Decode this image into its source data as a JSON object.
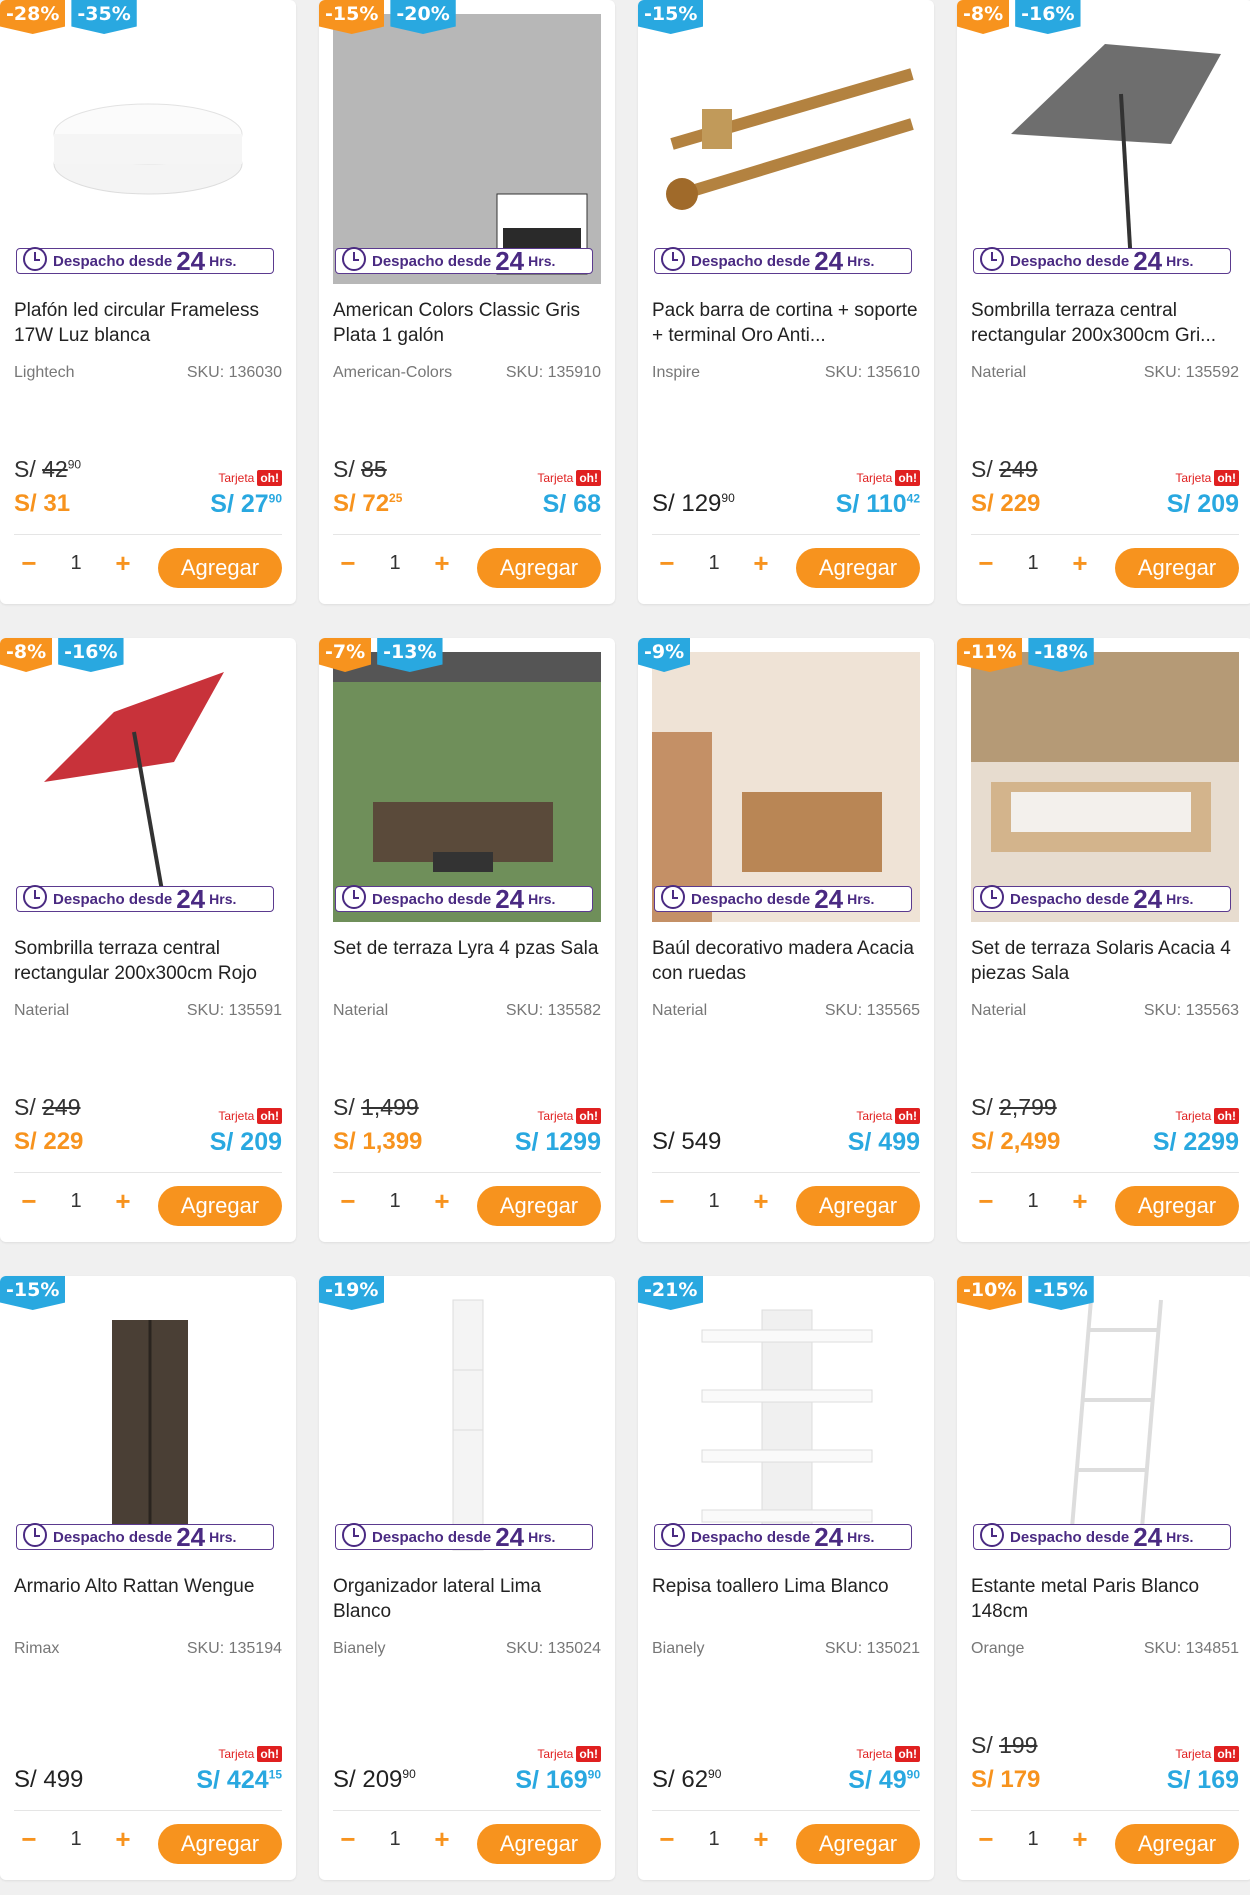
{
  "shipping": {
    "prefix": "Despacho desde",
    "num": "24",
    "unit": "Hrs."
  },
  "tarjeta_label": "Tarjeta",
  "tarjeta_oh": "oh!",
  "qty_minus": "−",
  "qty_plus": "+",
  "add_label": "Agregar",
  "currency": "S/",
  "accent_orange": "#f7931e",
  "accent_blue": "#29a8e0",
  "products": [
    {
      "badges": [
        "-28%",
        "-35%"
      ],
      "title": "Plafón led circular Frameless 17W Luz blanca",
      "brand": "Lightech",
      "sku": "SKU: 136030",
      "old": "42",
      "old_cents": "90",
      "price": "S/ 31",
      "price_cents": "",
      "tarjeta_price": "S/ 27",
      "tarjeta_cents": "90",
      "qty": "1",
      "icon": "ceiling-lamp"
    },
    {
      "badges": [
        "-15%",
        "-20%"
      ],
      "title": "American Colors Classic Gris Plata 1 galón",
      "brand": "American-Colors",
      "sku": "SKU: 135910",
      "old": "85",
      "old_cents": "",
      "price": "S/ 72",
      "price_cents": "25",
      "tarjeta_price": "S/ 68",
      "tarjeta_cents": "",
      "qty": "1",
      "icon": "paint-bucket"
    },
    {
      "badges": [
        "-15%"
      ],
      "title": "Pack barra de cortina + soporte + terminal Oro Anti...",
      "brand": "Inspire",
      "sku": "SKU: 135610",
      "old": "",
      "old_cents": "",
      "price": "S/ 129",
      "price_cents": "90",
      "tarjeta_price": "S/ 110",
      "tarjeta_cents": "42",
      "qty": "1",
      "icon": "curtain-rod"
    },
    {
      "badges": [
        "-8%",
        "-16%"
      ],
      "title": "Sombrilla terraza central rectangular 200x300cm Gri...",
      "brand": "Naterial",
      "sku": "SKU: 135592",
      "old": "249",
      "old_cents": "",
      "price": "S/ 229",
      "price_cents": "",
      "tarjeta_price": "S/ 209",
      "tarjeta_cents": "",
      "qty": "1",
      "icon": "umbrella-grey"
    },
    {
      "badges": [
        "-8%",
        "-16%"
      ],
      "title": "Sombrilla terraza central rectangular 200x300cm Rojo",
      "brand": "Naterial",
      "sku": "SKU: 135591",
      "old": "249",
      "old_cents": "",
      "price": "S/ 229",
      "price_cents": "",
      "tarjeta_price": "S/ 209",
      "tarjeta_cents": "",
      "qty": "1",
      "icon": "umbrella-red"
    },
    {
      "badges": [
        "-7%",
        "-13%"
      ],
      "title": "Set de terraza Lyra 4 pzas Sala",
      "brand": "Naterial",
      "sku": "SKU: 135582",
      "old": "1,499",
      "old_cents": "",
      "price": "S/ 1,399",
      "price_cents": "",
      "tarjeta_price": "S/ 1299",
      "tarjeta_cents": "",
      "qty": "1",
      "icon": "terrace-set"
    },
    {
      "badges": [
        "-9%"
      ],
      "title": "Baúl decorativo madera Acacia con ruedas",
      "brand": "Naterial",
      "sku": "SKU: 135565",
      "old": "",
      "old_cents": "",
      "price": "S/ 549",
      "price_cents": "",
      "tarjeta_price": "S/ 499",
      "tarjeta_cents": "",
      "qty": "1",
      "icon": "wooden-chest"
    },
    {
      "badges": [
        "-11%",
        "-18%"
      ],
      "title": "Set de terraza Solaris Acacia 4 piezas Sala",
      "brand": "Naterial",
      "sku": "SKU: 135563",
      "old": "2,799",
      "old_cents": "",
      "price": "S/ 2,499",
      "price_cents": "",
      "tarjeta_price": "S/ 2299",
      "tarjeta_cents": "",
      "qty": "1",
      "icon": "wood-sofa-set"
    },
    {
      "badges": [
        "-15%"
      ],
      "title": "Armario Alto Rattan Wengue",
      "brand": "Rimax",
      "sku": "SKU: 135194",
      "old": "",
      "old_cents": "",
      "price": "S/ 499",
      "price_cents": "",
      "tarjeta_price": "S/ 424",
      "tarjeta_cents": "15",
      "qty": "1",
      "icon": "cabinet"
    },
    {
      "badges": [
        "-19%"
      ],
      "title": "Organizador lateral Lima Blanco",
      "brand": "Bianely",
      "sku": "SKU: 135024",
      "old": "",
      "old_cents": "",
      "price": "S/ 209",
      "price_cents": "90",
      "tarjeta_price": "S/ 169",
      "tarjeta_cents": "90",
      "qty": "1",
      "icon": "tall-organizer"
    },
    {
      "badges": [
        "-21%"
      ],
      "title": "Repisa toallero Lima Blanco",
      "brand": "Bianely",
      "sku": "SKU: 135021",
      "old": "",
      "old_cents": "",
      "price": "S/ 62",
      "price_cents": "90",
      "tarjeta_price": "S/ 49",
      "tarjeta_cents": "90",
      "qty": "1",
      "icon": "shelf"
    },
    {
      "badges": [
        "-10%",
        "-15%"
      ],
      "title": "Estante metal Paris Blanco 148cm",
      "brand": "Orange",
      "sku": "SKU: 134851",
      "old": "199",
      "old_cents": "",
      "price": "S/ 179",
      "price_cents": "",
      "tarjeta_price": "S/ 169",
      "tarjeta_cents": "",
      "qty": "1",
      "icon": "ladder-shelf"
    }
  ]
}
